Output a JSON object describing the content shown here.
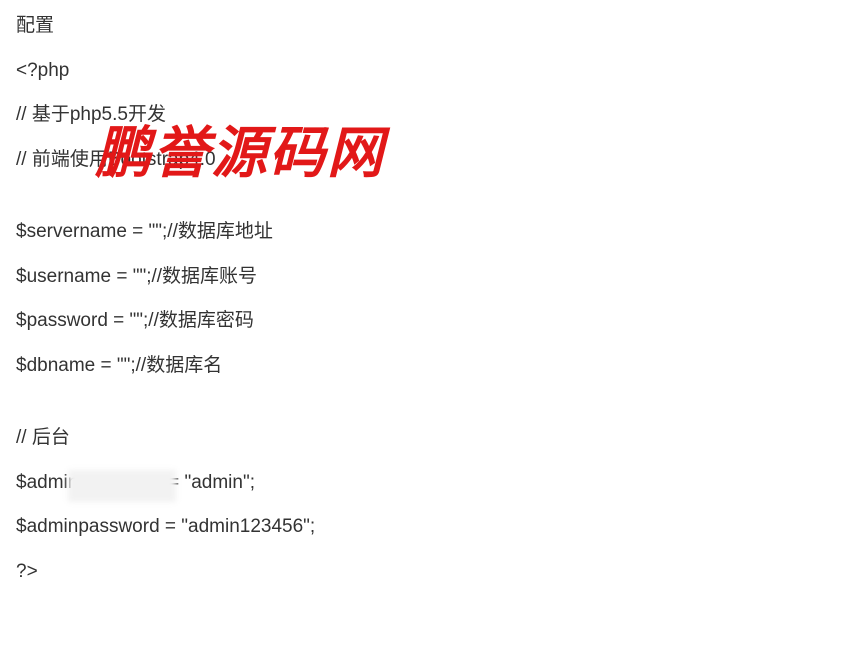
{
  "watermark": "鹏誉源码网",
  "lines": {
    "l0": "配置",
    "l1": "<?php",
    "l2": "// 基于php5.5开发",
    "l3": "// 前端使用Bootstrap4.0",
    "l4": "$servername = \"\";//数据库地址",
    "l5": "$username = \"\";//数据库账号",
    "l6": "$password = \"\";//数据库密码",
    "l7": "$dbname = \"\";//数据库名",
    "l8": "// 后台",
    "l9": "$adminusername = \"admin\";",
    "l10": "$adminpassword = \"admin123456\";",
    "l11": "?>"
  }
}
